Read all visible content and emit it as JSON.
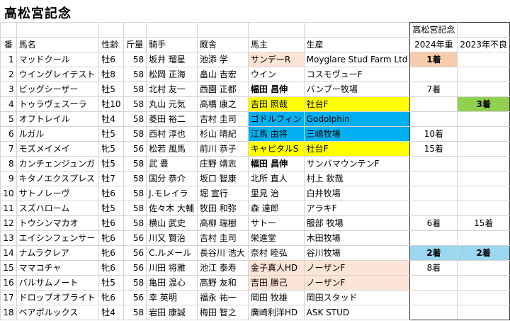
{
  "title": "高松宮記念",
  "header_group": "高松宮記念",
  "columns": {
    "no": "番",
    "horse": "馬名",
    "sex_age": "性齢",
    "weight": "斤量",
    "jockey": "騎手",
    "trainer": "厩舎",
    "owner": "馬主",
    "breeder": "生産",
    "y2024": "2024年重",
    "y2023": "2023年不良"
  },
  "colors": {
    "salmon": "#fce4d6",
    "yellow": "#ffff00",
    "blue": "#00b0f0",
    "orange": "#f8cbad",
    "green": "#92d050",
    "light_blue": "#9bd7f0"
  },
  "rows": [
    {
      "no": "1",
      "horse": "マッドクール",
      "sex_age": "牡6",
      "weight": "58",
      "jockey": "坂井 瑠星",
      "trainer": "池添 学",
      "owner": "サンデーR",
      "breeder": "Moyglare Stud Farm Ltd",
      "y2024": "1着",
      "y2023": ""
    },
    {
      "no": "2",
      "horse": "ウイングレイテスト",
      "sex_age": "牡8",
      "weight": "58",
      "jockey": "松岡 正海",
      "trainer": "畠山 吉宏",
      "owner": "ウイン",
      "breeder": "コスモヴューF",
      "y2024": "",
      "y2023": ""
    },
    {
      "no": "3",
      "horse": "ビッグシーザー",
      "sex_age": "牡5",
      "weight": "58",
      "jockey": "北村 友一",
      "trainer": "西園 正都",
      "owner": "幅田 昌伸",
      "breeder": "バンブー牧場",
      "y2024": "7着",
      "y2023": ""
    },
    {
      "no": "4",
      "horse": "トゥラヴェスーラ",
      "sex_age": "牡10",
      "weight": "58",
      "jockey": "丸山 元気",
      "trainer": "高橋 康之",
      "owner": "吉田 照哉",
      "breeder": "社台F",
      "y2024": "",
      "y2023": "3着"
    },
    {
      "no": "5",
      "horse": "オフトレイル",
      "sex_age": "牡4",
      "weight": "58",
      "jockey": "菱田 裕二",
      "trainer": "吉村 圭司",
      "owner": "ゴドルフィン",
      "breeder": "Godolphin",
      "y2024": "",
      "y2023": ""
    },
    {
      "no": "6",
      "horse": "ルガル",
      "sex_age": "牡5",
      "weight": "58",
      "jockey": "西村 淳也",
      "trainer": "杉山 晴紀",
      "owner": "江馬 由将",
      "breeder": "三嶋牧場",
      "y2024": "10着",
      "y2023": ""
    },
    {
      "no": "7",
      "horse": "モズメイメイ",
      "sex_age": "牝5",
      "weight": "56",
      "jockey": "松若 風馬",
      "trainer": "前川 恭子",
      "owner": "キャピタルS",
      "breeder": "社台F",
      "y2024": "15着",
      "y2023": ""
    },
    {
      "no": "8",
      "horse": "カンチェンジュンガ",
      "sex_age": "牡5",
      "weight": "58",
      "jockey": "武 豊",
      "trainer": "庄野 靖志",
      "owner": "幅田 昌伸",
      "breeder": "サンバマウンテンF",
      "y2024": "",
      "y2023": ""
    },
    {
      "no": "9",
      "horse": "キタノエクスプレス",
      "sex_age": "牡7",
      "weight": "58",
      "jockey": "国分 恭介",
      "trainer": "坂口 智康",
      "owner": "北所 直人",
      "breeder": "村上 欽哉",
      "y2024": "",
      "y2023": ""
    },
    {
      "no": "10",
      "horse": "サトノレーヴ",
      "sex_age": "牡6",
      "weight": "58",
      "jockey": "J.モレイラ",
      "trainer": "堀 宣行",
      "owner": "里見 治",
      "breeder": "白井牧場",
      "y2024": "",
      "y2023": ""
    },
    {
      "no": "11",
      "horse": "スズハローム",
      "sex_age": "牡5",
      "weight": "58",
      "jockey": "佐々木 大輔",
      "trainer": "牧田 和弥",
      "owner": "森 達郎",
      "breeder": "アラキF",
      "y2024": "",
      "y2023": ""
    },
    {
      "no": "12",
      "horse": "トウシンマカオ",
      "sex_age": "牡6",
      "weight": "58",
      "jockey": "横山 武史",
      "trainer": "高柳 瑞樹",
      "owner": "サトー",
      "breeder": "服部 牧場",
      "y2024": "6着",
      "y2023": "15着"
    },
    {
      "no": "13",
      "horse": "エイシンフェンサー",
      "sex_age": "牝6",
      "weight": "56",
      "jockey": "川又 賢治",
      "trainer": "吉村 圭司",
      "owner": "栄進堂",
      "breeder": "木田牧場",
      "y2024": "",
      "y2023": ""
    },
    {
      "no": "14",
      "horse": "ナムラクレア",
      "sex_age": "牝6",
      "weight": "56",
      "jockey": "C.ルメール",
      "trainer": "長谷川 浩大",
      "owner": "奈村 睦弘",
      "breeder": "谷川牧場",
      "y2024": "2着",
      "y2023": "2着"
    },
    {
      "no": "15",
      "horse": "ママコチャ",
      "sex_age": "牝6",
      "weight": "56",
      "jockey": "川田 将雅",
      "trainer": "池江 泰寿",
      "owner": "金子真人HD",
      "breeder": "ノーザンF",
      "y2024": "8着",
      "y2023": ""
    },
    {
      "no": "16",
      "horse": "バルサムノート",
      "sex_age": "牡5",
      "weight": "58",
      "jockey": "亀田 温心",
      "trainer": "高野 友和",
      "owner": "吉田 勝己",
      "breeder": "ノーザンF",
      "y2024": "",
      "y2023": ""
    },
    {
      "no": "17",
      "horse": "ドロップオブライト",
      "sex_age": "牝6",
      "weight": "56",
      "jockey": "幸 英明",
      "trainer": "福永 祐一",
      "owner": "岡田 牧雄",
      "breeder": "岡田スタッド",
      "y2024": "",
      "y2023": ""
    },
    {
      "no": "18",
      "horse": "ペアポルックス",
      "sex_age": "牡4",
      "weight": "58",
      "jockey": "岩田 康誠",
      "trainer": "梅田 智之",
      "owner": "廣崎利洋HD",
      "breeder": "ASK STUD",
      "y2024": "",
      "y2023": ""
    }
  ]
}
